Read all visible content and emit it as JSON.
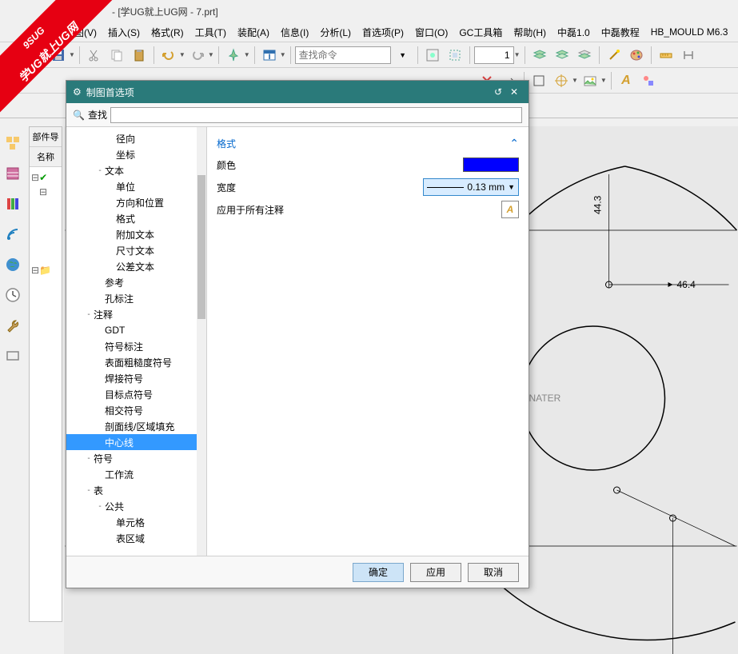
{
  "title": " - [学UG就上UG网 - 7.prt]",
  "menus": [
    "视图(V)",
    "插入(S)",
    "格式(R)",
    "工具(T)",
    "装配(A)",
    "信息(I)",
    "分析(L)",
    "首选项(P)",
    "窗口(O)",
    "GC工具箱",
    "帮助(H)",
    "中磊1.0",
    "中磊教程",
    "HB_MOULD M6.3"
  ],
  "toolbar": {
    "search_placeholder": "查找命令",
    "number_value": "1"
  },
  "partnav": {
    "header1": "部件导",
    "header2": "名称"
  },
  "canvas": {
    "dim1": "44.3",
    "dim2": "46.4",
    "text1": "NATER"
  },
  "dialog": {
    "title": "制图首选项",
    "search_label": "查找",
    "tree": [
      {
        "label": "径向",
        "indent": 3
      },
      {
        "label": "坐标",
        "indent": 3
      },
      {
        "label": "文本",
        "indent": 2,
        "exp": "-"
      },
      {
        "label": "单位",
        "indent": 3
      },
      {
        "label": "方向和位置",
        "indent": 3
      },
      {
        "label": "格式",
        "indent": 3
      },
      {
        "label": "附加文本",
        "indent": 3
      },
      {
        "label": "尺寸文本",
        "indent": 3
      },
      {
        "label": "公差文本",
        "indent": 3
      },
      {
        "label": "参考",
        "indent": 2
      },
      {
        "label": "孔标注",
        "indent": 2
      },
      {
        "label": "注释",
        "indent": 1,
        "exp": "-"
      },
      {
        "label": "GDT",
        "indent": 2
      },
      {
        "label": "符号标注",
        "indent": 2
      },
      {
        "label": "表面粗糙度符号",
        "indent": 2
      },
      {
        "label": "焊接符号",
        "indent": 2
      },
      {
        "label": "目标点符号",
        "indent": 2
      },
      {
        "label": "相交符号",
        "indent": 2
      },
      {
        "label": "剖面线/区域填充",
        "indent": 2
      },
      {
        "label": "中心线",
        "indent": 2,
        "selected": true
      },
      {
        "label": "符号",
        "indent": 1,
        "exp": "-"
      },
      {
        "label": "工作流",
        "indent": 2
      },
      {
        "label": "表",
        "indent": 1,
        "exp": "-"
      },
      {
        "label": "公共",
        "indent": 2,
        "exp": "-"
      },
      {
        "label": "单元格",
        "indent": 3
      },
      {
        "label": "表区域",
        "indent": 3
      }
    ],
    "section": "格式",
    "color_label": "颜色",
    "width_label": "宽度",
    "width_value": "0.13 mm",
    "apply_all": "应用于所有注释",
    "ok": "确定",
    "apply": "应用",
    "cancel": "取消"
  },
  "watermark": {
    "line1": "9SUG",
    "line2": "学UG就上UG网"
  }
}
